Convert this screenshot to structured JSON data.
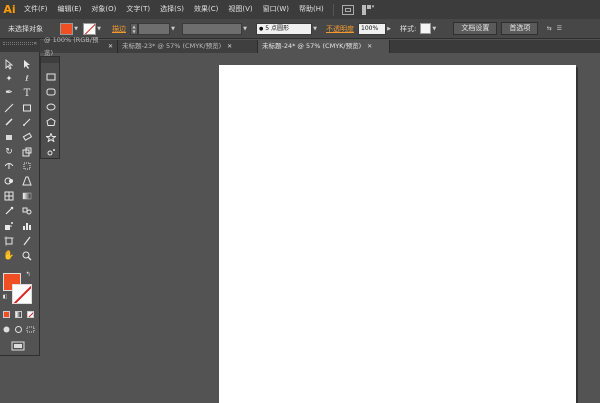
{
  "app": {
    "logo": "Ai"
  },
  "menu": [
    {
      "label": "文件(F)"
    },
    {
      "label": "编辑(E)"
    },
    {
      "label": "对象(O)"
    },
    {
      "label": "文字(T)"
    },
    {
      "label": "选择(S)"
    },
    {
      "label": "效果(C)"
    },
    {
      "label": "视图(V)"
    },
    {
      "label": "窗口(W)"
    },
    {
      "label": "帮助(H)"
    }
  ],
  "control": {
    "selection_status": "未选择对象",
    "stroke_label": "描边",
    "brush_value": "5 点圆形",
    "opacity_label": "不透明度",
    "opacity_value": "100%",
    "style_label": "样式:",
    "doc_setup_button": "文档设置",
    "preferences_button": "首选项",
    "fill_color": "#f04e23"
  },
  "tabs": [
    {
      "label": "@ 100% (RGB/预览)",
      "active": false
    },
    {
      "label": "未标题-23* @ 57% (CMYK/预览)",
      "active": false
    },
    {
      "label": "未标题-24* @ 57% (CMYK/预览)",
      "active": true
    }
  ],
  "colors": {
    "fill": "#f04e23",
    "stroke_none": "#e02020",
    "artboard": "#ffffff",
    "pasteboard": "#535353"
  }
}
